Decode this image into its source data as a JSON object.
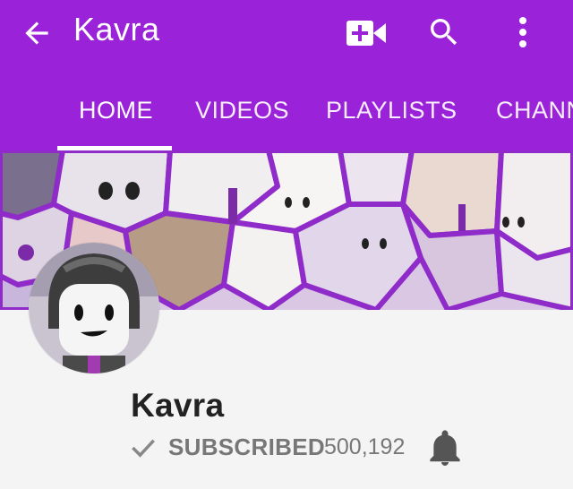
{
  "header": {
    "title": "Kavra",
    "icons": [
      "back-arrow-icon",
      "video-add-icon",
      "search-icon",
      "more-vert-icon"
    ],
    "background_color": "#9a22d8"
  },
  "tabs": [
    {
      "label": "HOME",
      "active": true
    },
    {
      "label": "VIDEOS",
      "active": false
    },
    {
      "label": "PLAYLISTS",
      "active": false
    },
    {
      "label": "CHANN",
      "active": false
    }
  ],
  "channel": {
    "name": "Kavra",
    "subscribed_label": "SUBSCRIBED",
    "subscriber_count": "500,192",
    "check_icon": "check-icon",
    "bell_icon": "bell-icon"
  }
}
